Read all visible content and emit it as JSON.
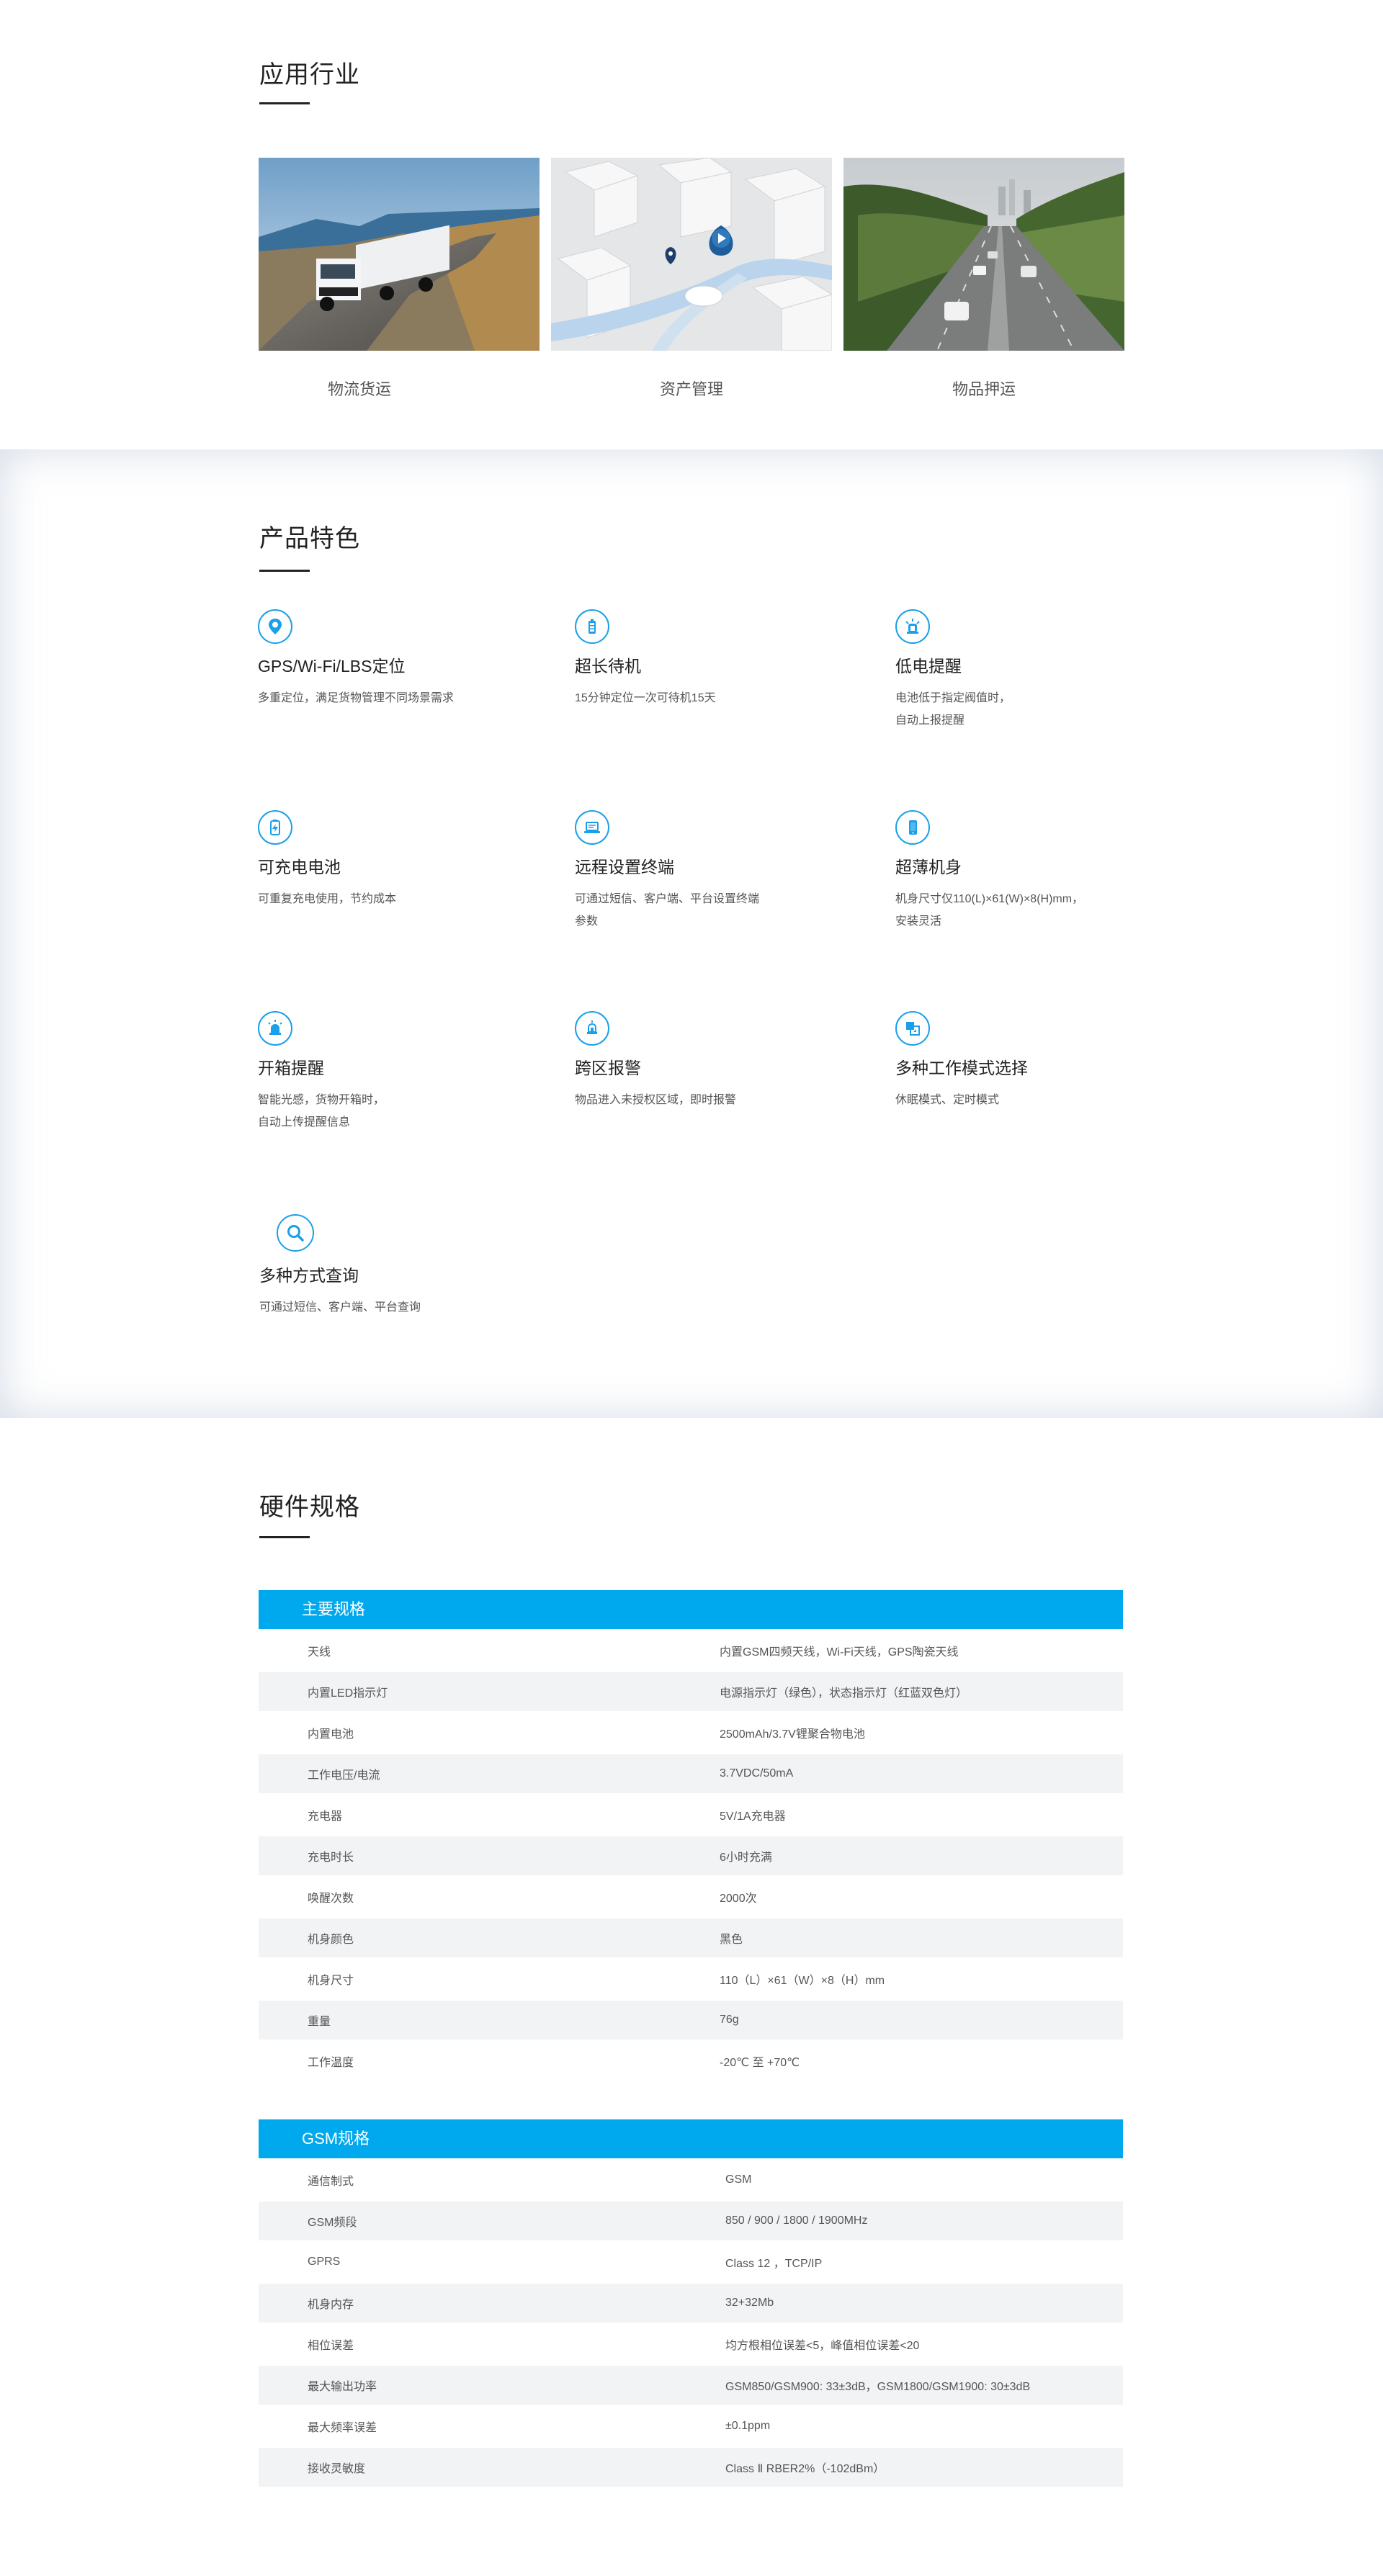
{
  "industry": {
    "title": "应用行业",
    "cards": [
      {
        "label": "物流货运"
      },
      {
        "label": "资产管理"
      },
      {
        "label": "物品押运"
      }
    ]
  },
  "features": {
    "title": "产品特色",
    "items": [
      {
        "name": "GPS/Wi-Fi/LBS定位",
        "desc": "多重定位，满足货物管理不同场景需求",
        "icon": "location-pin-icon"
      },
      {
        "name": "超长待机",
        "desc": "15分钟定位一次可待机15天",
        "icon": "battery-icon"
      },
      {
        "name": "低电提醒",
        "desc": "电池低于指定阀值时，\n自动上报提醒",
        "icon": "alarm-icon"
      },
      {
        "name": "可充电电池",
        "desc": "可重复充电使用，节约成本",
        "icon": "charge-icon"
      },
      {
        "name": "远程设置终端",
        "desc": "可通过短信、客户端、平台设置终端\n参数",
        "icon": "laptop-icon"
      },
      {
        "name": "超薄机身",
        "desc": "机身尺寸仅110(L)×61(W)×8(H)mm，\n安装灵活",
        "icon": "phone-icon"
      },
      {
        "name": "开箱提醒",
        "desc": "智能光感，货物开箱时，\n自动上传提醒信息",
        "icon": "siren-icon"
      },
      {
        "name": "跨区报警",
        "desc": "物品进入未授权区域，即时报警",
        "icon": "bell-icon"
      },
      {
        "name": "多种工作模式选择",
        "desc": "休眠模式、定时模式",
        "icon": "mode-icon"
      },
      {
        "name": "多种方式查询",
        "desc": "可通过短信、客户端、平台查询",
        "icon": "search-icon"
      }
    ]
  },
  "specs": {
    "title": "硬件规格",
    "main": {
      "header": "主要规格",
      "rows": [
        {
          "k": "天线",
          "v": "内置GSM四频天线，Wi-Fi天线，GPS陶瓷天线"
        },
        {
          "k": "内置LED指示灯",
          "v": "电源指示灯（绿色），状态指示灯（红蓝双色灯）"
        },
        {
          "k": "内置电池",
          "v": "2500mAh/3.7V锂聚合物电池"
        },
        {
          "k": "工作电压/电流",
          "v": "3.7VDC/50mA"
        },
        {
          "k": "充电器",
          "v": "5V/1A充电器"
        },
        {
          "k": "充电时长",
          "v": "6小时充满"
        },
        {
          "k": "唤醒次数",
          "v": "2000次"
        },
        {
          "k": "机身颜色",
          "v": "黑色"
        },
        {
          "k": "机身尺寸",
          "v": "110（L）×61（W）×8（H）mm"
        },
        {
          "k": "重量",
          "v": "76g"
        },
        {
          "k": "工作温度",
          "v": "-20℃ 至 +70℃"
        }
      ]
    },
    "gsm": {
      "header": "GSM规格",
      "rows": [
        {
          "k": "通信制式",
          "v": "GSM"
        },
        {
          "k": "GSM频段",
          "v": "850 / 900 / 1800 / 1900MHz"
        },
        {
          "k": "GPRS",
          "v": "Class 12 ，TCP/IP"
        },
        {
          "k": "机身内存",
          "v": "32+32Mb"
        },
        {
          "k": "相位误差",
          "v": "均方根相位误差<5，峰值相位误差<20"
        },
        {
          "k": "最大输出功率",
          "v": "GSM850/GSM900: 33±3dB，GSM1800/GSM1900: 30±3dB"
        },
        {
          "k": "最大频率误差",
          "v": "±0.1ppm"
        },
        {
          "k": "接收灵敏度",
          "v": "Class Ⅱ RBER2%（-102dBm）"
        }
      ]
    }
  }
}
